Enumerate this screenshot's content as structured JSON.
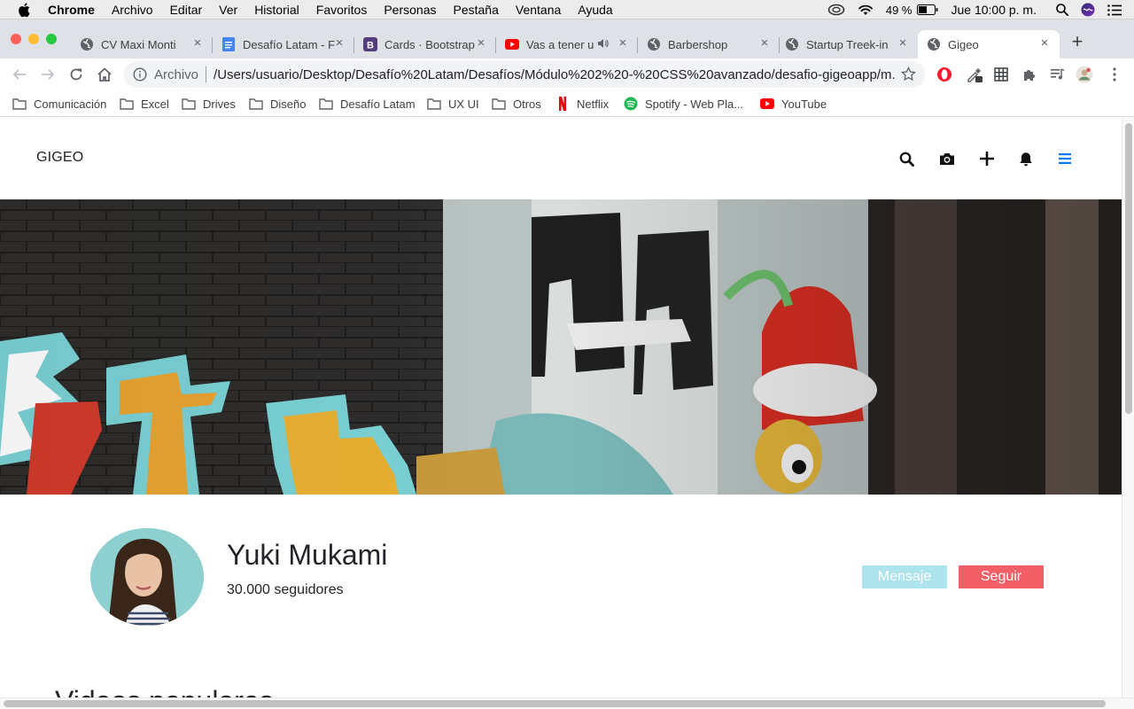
{
  "menubar": {
    "app": "Chrome",
    "items": [
      "Archivo",
      "Editar",
      "Ver",
      "Historial",
      "Favoritos",
      "Personas",
      "Pestaña",
      "Ventana",
      "Ayuda"
    ],
    "battery": "49 %",
    "clock": "Jue 10:00 p. m."
  },
  "tabs": [
    {
      "title": "CV Maxi Monti",
      "icon": "globe-icon"
    },
    {
      "title": "Desafío Latam - F",
      "icon": "docs-icon"
    },
    {
      "title": "Cards · Bootstrap",
      "icon": "bootstrap-icon"
    },
    {
      "title": "Vas a tener u",
      "icon": "youtube-icon"
    },
    {
      "title": "Barbershop",
      "icon": "globe-icon"
    },
    {
      "title": "Startup Treek-in",
      "icon": "globe-icon"
    },
    {
      "title": "Gigeo",
      "icon": "globe-icon"
    }
  ],
  "omnibox": {
    "scheme": "Archivo",
    "url": "/Users/usuario/Desktop/Desafío%20Latam/Desafíos/Módulo%202%20-%20CSS%20avanzado/desafio-gigeoapp/m..."
  },
  "bookmarks": [
    {
      "label": "Comunicación",
      "icon": "folder-icon"
    },
    {
      "label": "Excel",
      "icon": "folder-icon"
    },
    {
      "label": "Drives",
      "icon": "folder-icon"
    },
    {
      "label": "Diseño",
      "icon": "folder-icon"
    },
    {
      "label": "Desafío Latam",
      "icon": "folder-icon"
    },
    {
      "label": "UX UI",
      "icon": "folder-icon"
    },
    {
      "label": "Otros",
      "icon": "folder-icon"
    },
    {
      "label": "Netflix",
      "icon": "netflix-icon"
    },
    {
      "label": "Spotify - Web Pla...",
      "icon": "spotify-icon"
    },
    {
      "label": "YouTube",
      "icon": "youtube-icon"
    }
  ],
  "site": {
    "brand": "GIGEO",
    "nav_icons": [
      "search-icon",
      "camera-icon",
      "plus-icon",
      "bell-icon",
      "hamburger-menu-icon"
    ],
    "profile": {
      "name": "Yuki Mukami",
      "followers": "30.000 seguidores",
      "message_label": "Mensaje",
      "follow_label": "Seguir"
    },
    "section_title": "Videos populares"
  },
  "colors": {
    "accent_menu": "#007bff",
    "message_button": "#aee4ee",
    "follow_button": "#f35f67"
  }
}
